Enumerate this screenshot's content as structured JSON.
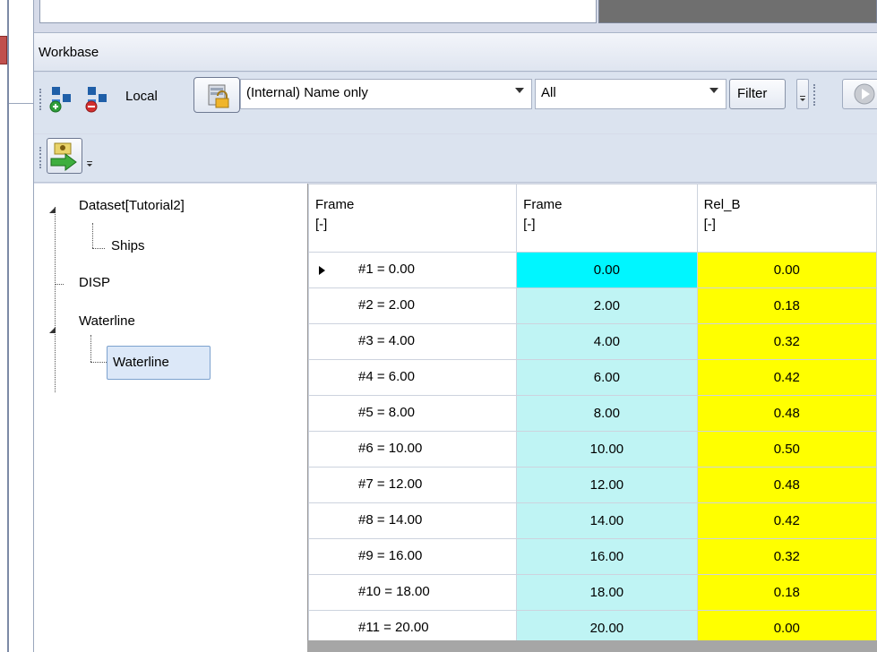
{
  "workbase": {
    "title": "Workbase"
  },
  "toolbar": {
    "local_label": "Local",
    "name_mode": {
      "value": "(Internal) Name only"
    },
    "filter_scope": {
      "value": "All"
    },
    "filter_label": "Filter"
  },
  "tree": {
    "items": [
      {
        "label": "Dataset[Tutorial2]"
      },
      {
        "label": "Ships"
      },
      {
        "label": "DISP"
      },
      {
        "label": "Waterline"
      },
      {
        "label": "Waterline"
      }
    ]
  },
  "grid": {
    "columns": [
      {
        "name": "Frame",
        "unit": "[-]"
      },
      {
        "name": "Frame",
        "unit": "[-]"
      },
      {
        "name": "Rel_B",
        "unit": "[-]"
      }
    ],
    "rows": [
      {
        "label": "#1 = 0.00",
        "frame": "0.00",
        "rel_b": "0.00"
      },
      {
        "label": "#2 = 2.00",
        "frame": "2.00",
        "rel_b": "0.18"
      },
      {
        "label": "#3 = 4.00",
        "frame": "4.00",
        "rel_b": "0.32"
      },
      {
        "label": "#4 = 6.00",
        "frame": "6.00",
        "rel_b": "0.42"
      },
      {
        "label": "#5 = 8.00",
        "frame": "8.00",
        "rel_b": "0.48"
      },
      {
        "label": "#6 = 10.00",
        "frame": "10.00",
        "rel_b": "0.50"
      },
      {
        "label": "#7 = 12.00",
        "frame": "12.00",
        "rel_b": "0.48"
      },
      {
        "label": "#8 = 14.00",
        "frame": "14.00",
        "rel_b": "0.42"
      },
      {
        "label": "#9 = 16.00",
        "frame": "16.00",
        "rel_b": "0.32"
      },
      {
        "label": "#10 = 18.00",
        "frame": "18.00",
        "rel_b": "0.18"
      },
      {
        "label": "#11 = 20.00",
        "frame": "20.00",
        "rel_b": "0.00"
      }
    ]
  },
  "colors": {
    "active_cell": "#00f6ff",
    "frame_column": "#bff4f4",
    "rel_b_column": "#ffff00"
  }
}
